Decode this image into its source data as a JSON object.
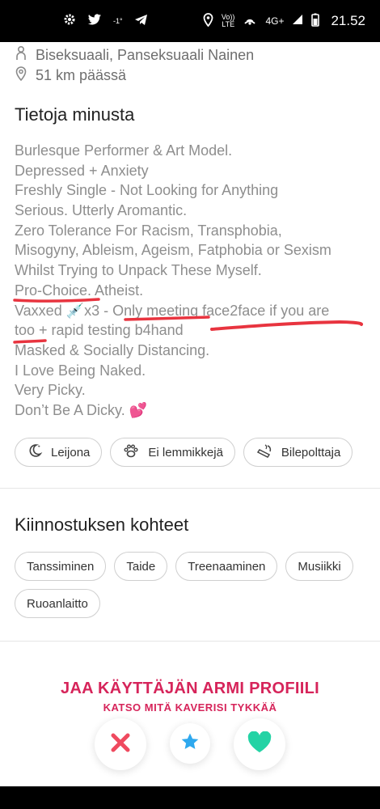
{
  "status_bar": {
    "left_small": "-1°",
    "network_label_top": "Vo))",
    "network_label_bottom": "LTE",
    "network_type": "4G+",
    "time": "21.52",
    "icons": [
      "gear-icon",
      "twitter-icon",
      "telegram-icon",
      "location-icon",
      "hotspot-icon",
      "signal-icon",
      "battery-icon"
    ]
  },
  "profile": {
    "orientation": "Biseksuaali, Panseksuaali Nainen",
    "distance": "51 km päässä"
  },
  "about": {
    "title": "Tietoja minusta",
    "lines": [
      "Burlesque Performer & Art Model.",
      "Depressed + Anxiety",
      "Freshly Single - Not Looking for Anything",
      "Serious. Utterly Aromantic.",
      "Zero Tolerance For Racism, Transphobia,",
      "Misogyny, Ableism, Ageism, Fatphobia or Sexism",
      "Whilst Trying to Unpack These Myself.",
      "Pro-Choice. Atheist.",
      "Vaxxed 💉x3 - Only meeting face2face if you are",
      "too + rapid testing b4hand",
      "Masked & Socially Distancing.",
      "I Love Being Naked.",
      "Very Picky.",
      "Don’t Be A Dicky. 💕"
    ],
    "lifestyle_chips": [
      {
        "label": "Leijona",
        "icon": "moon-icon"
      },
      {
        "label": "Ei lemmikkejä",
        "icon": "paw-icon"
      },
      {
        "label": "Bilepolttaja",
        "icon": "cigarette-icon"
      }
    ]
  },
  "interests": {
    "title": "Kiinnostuksen kohteet",
    "row1": [
      "Tanssiminen",
      "Taide",
      "Treenaaminen",
      "Musiikki"
    ],
    "row2": [
      "Ruoanlaitto"
    ]
  },
  "share": {
    "title": "JAA KÄYTTÄJÄN ARMI PROFIILI",
    "subtitle": "KATSO MITÄ KAVERISI TYKKÄÄ"
  },
  "actions": [
    {
      "name": "nope-button",
      "icon": "x-icon"
    },
    {
      "name": "super-like-button",
      "icon": "star-icon"
    },
    {
      "name": "like-button",
      "icon": "heart-icon"
    }
  ],
  "colors": {
    "accent_red": "#d6245a",
    "nope": "#ef4a5f",
    "super_like": "#2ea8ee",
    "like": "#24d3a5",
    "annotation": "#e8343f"
  }
}
